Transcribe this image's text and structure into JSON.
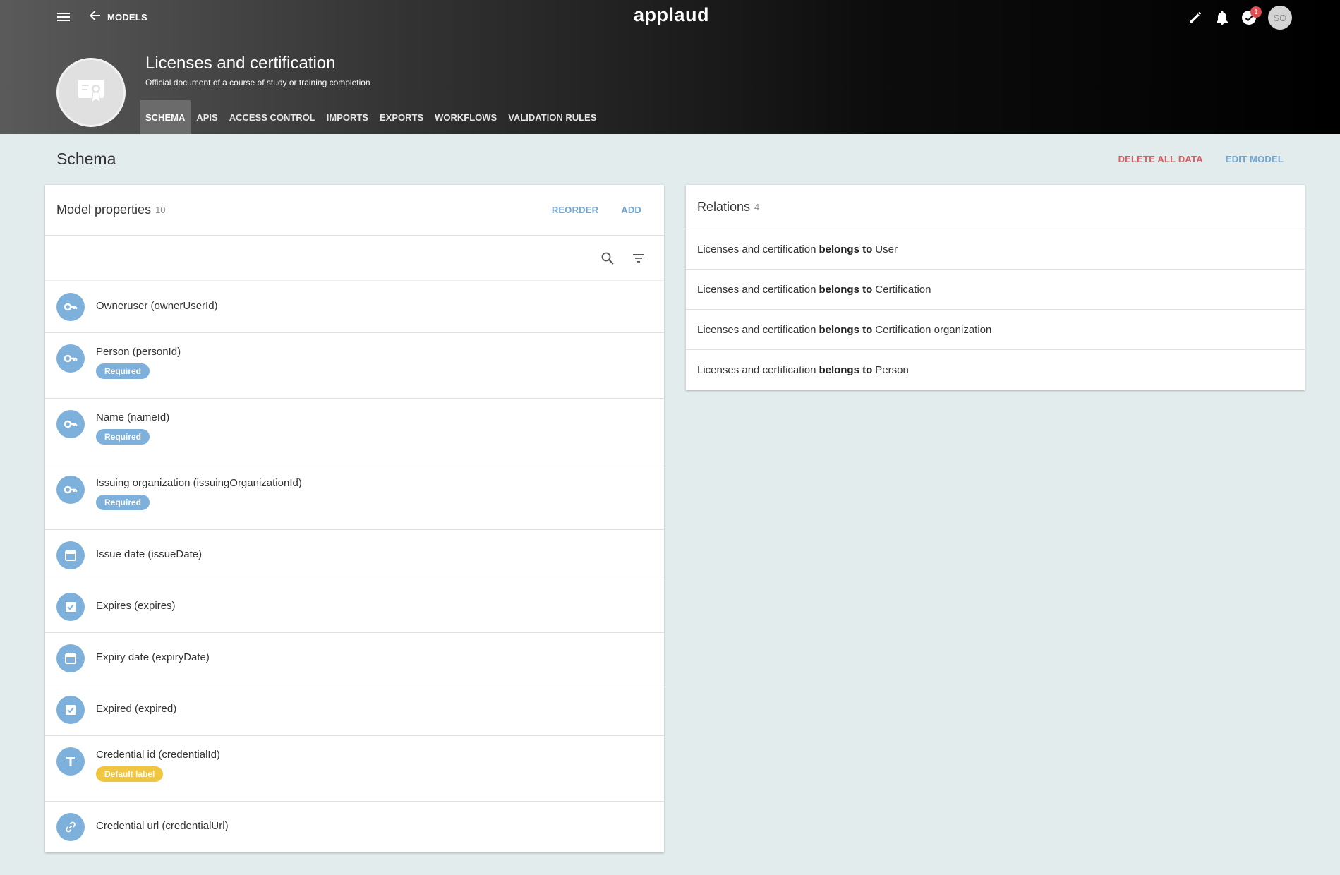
{
  "header": {
    "back_label": "MODELS",
    "logo": "applaud",
    "notification_count": "1",
    "avatar_initials": "SO"
  },
  "model": {
    "title": "Licenses and certification",
    "description": "Official document of a course of study or training completion"
  },
  "tabs": [
    {
      "label": "SCHEMA",
      "active": true
    },
    {
      "label": "APIS"
    },
    {
      "label": "ACCESS CONTROL"
    },
    {
      "label": "IMPORTS"
    },
    {
      "label": "EXPORTS"
    },
    {
      "label": "WORKFLOWS"
    },
    {
      "label": "VALIDATION RULES"
    }
  ],
  "page": {
    "title": "Schema",
    "delete_label": "DELETE ALL DATA",
    "edit_label": "EDIT MODEL"
  },
  "properties": {
    "title": "Model properties",
    "count": "10",
    "reorder_label": "REORDER",
    "add_label": "ADD",
    "items": [
      {
        "name": "Owneruser (ownerUserId)",
        "icon": "key-icon"
      },
      {
        "name": "Person (personId)",
        "icon": "key-icon",
        "badge": "Required"
      },
      {
        "name": "Name (nameId)",
        "icon": "key-icon",
        "badge": "Required"
      },
      {
        "name": "Issuing organization (issuingOrganizationId)",
        "icon": "key-icon",
        "badge": "Required"
      },
      {
        "name": "Issue date (issueDate)",
        "icon": "calendar-icon"
      },
      {
        "name": "Expires (expires)",
        "icon": "checkbox-icon"
      },
      {
        "name": "Expiry date (expiryDate)",
        "icon": "calendar-icon"
      },
      {
        "name": "Expired (expired)",
        "icon": "checkbox-icon"
      },
      {
        "name": "Credential id (credentialId)",
        "icon": "text-icon",
        "badge": "Default label"
      },
      {
        "name": "Credential url (credentialUrl)",
        "icon": "link-icon"
      }
    ]
  },
  "relations": {
    "title": "Relations",
    "count": "4",
    "items": [
      {
        "source": "Licenses and certification",
        "verb": "belongs to",
        "target": "User"
      },
      {
        "source": "Licenses and certification",
        "verb": "belongs to",
        "target": "Certification"
      },
      {
        "source": "Licenses and certification",
        "verb": "belongs to",
        "target": "Certification organization"
      },
      {
        "source": "Licenses and certification",
        "verb": "belongs to",
        "target": "Person"
      }
    ]
  },
  "colors": {
    "accent": "#6ea7d6",
    "danger": "#e05a61",
    "prop_icon_bg": "#7eb0dc",
    "default_badge": "#f0c540"
  }
}
